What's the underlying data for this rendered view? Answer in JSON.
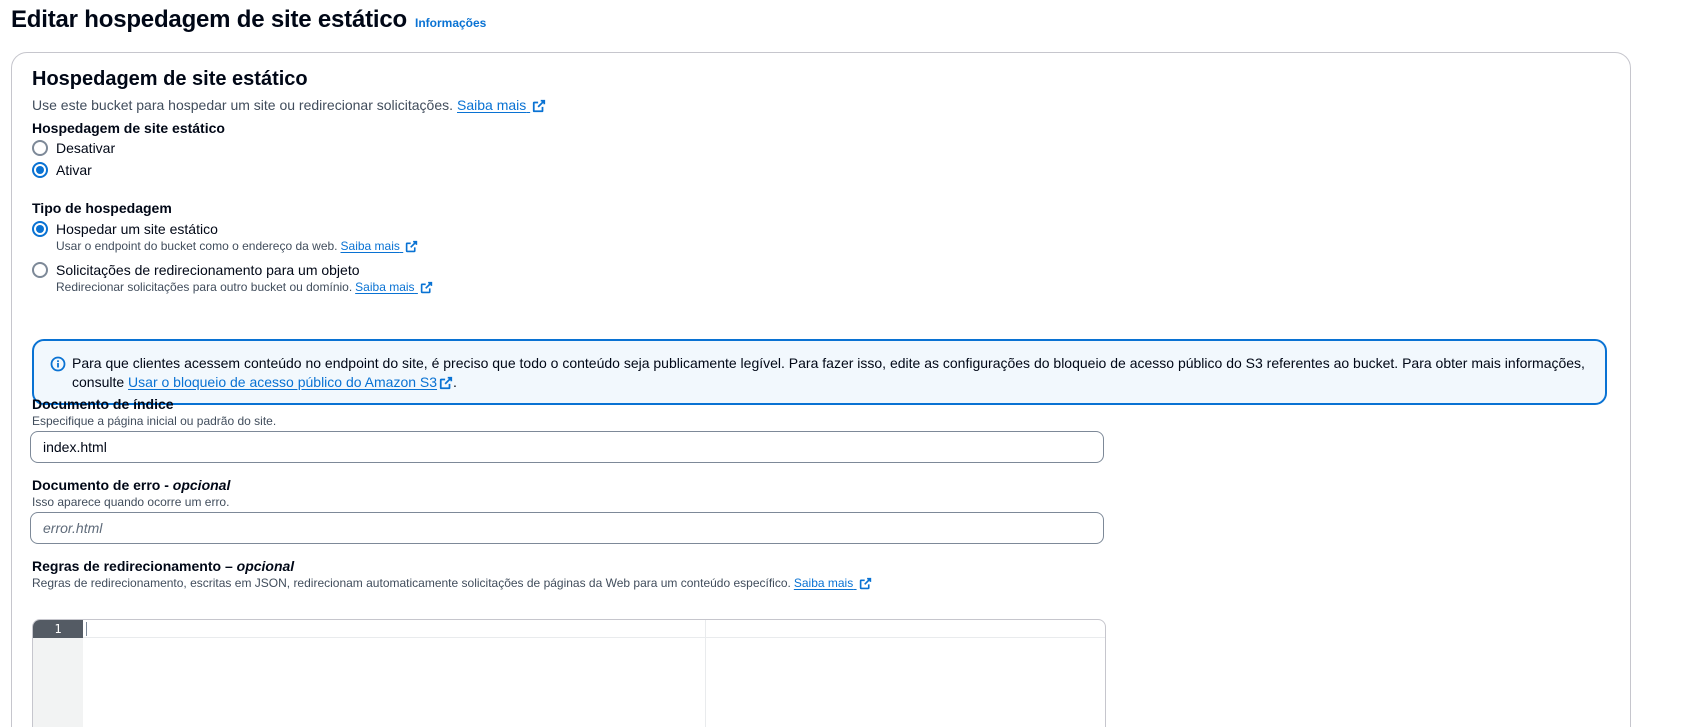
{
  "header": {
    "title": "Editar hospedagem de site estático",
    "info_link": "Informações"
  },
  "section": {
    "title": "Hospedagem de site estático",
    "description": "Use este bucket para hospedar um site ou redirecionar solicitações.",
    "learn_more": "Saiba mais"
  },
  "static_hosting": {
    "label": "Hospedagem de site estático",
    "options": [
      {
        "label": "Desativar",
        "selected": false
      },
      {
        "label": "Ativar",
        "selected": true
      }
    ]
  },
  "hosting_type": {
    "label": "Tipo de hospedagem",
    "options": [
      {
        "label": "Hospedar um site estático",
        "description": "Usar o endpoint do bucket como o endereço da web.",
        "learn_more": "Saiba mais",
        "selected": true
      },
      {
        "label": "Solicitações de redirecionamento para um objeto",
        "description": "Redirecionar solicitações para outro bucket ou domínio.",
        "learn_more": "Saiba mais",
        "selected": false
      }
    ]
  },
  "alert": {
    "text_before": "Para que clientes acessem conteúdo no endpoint do site, é preciso que todo o conteúdo seja publicamente legível. Para fazer isso, edite as configurações do bloqueio de acesso público do S3 referentes ao bucket. Para obter mais informações, consulte",
    "link": "Usar o bloqueio de acesso público do Amazon S3",
    "text_after": "."
  },
  "index_document": {
    "label": "Documento de índice",
    "hint": "Especifique a página inicial ou padrão do site.",
    "value": "index.html"
  },
  "error_document": {
    "label": "Documento de erro -",
    "optional": "opcional",
    "hint": "Isso aparece quando ocorre um erro.",
    "placeholder": "error.html"
  },
  "redirect_rules": {
    "label": "Regras de redirecionamento –",
    "optional": "opcional",
    "hint": "Regras de redirecionamento, escritas em JSON, redirecionam automaticamente solicitações de páginas da Web para um conteúdo específico.",
    "learn_more": "Saiba mais",
    "line_number": "1"
  },
  "colors": {
    "link": "#0972d3",
    "alert_bg": "#f2f8fd",
    "text": "#000716",
    "secondary_text": "#414d5c"
  }
}
